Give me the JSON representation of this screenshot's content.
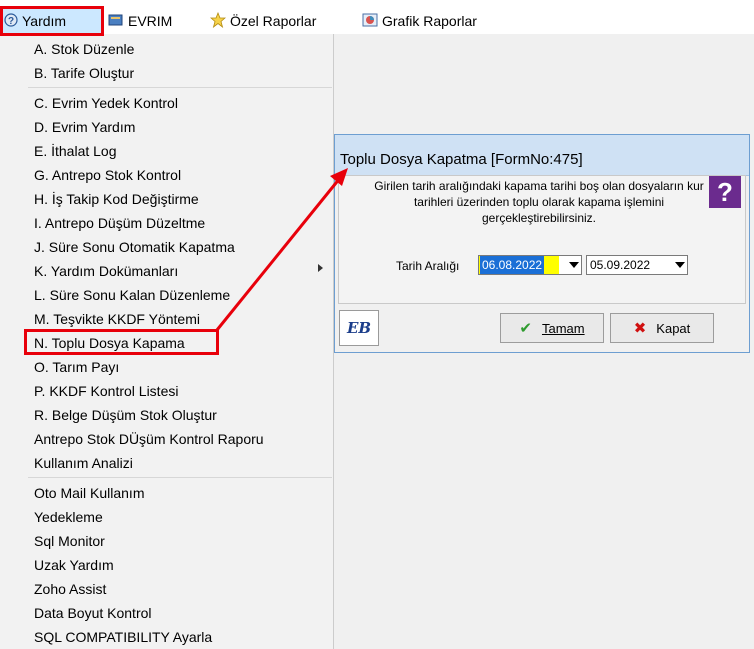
{
  "menubar": {
    "items": [
      {
        "label": "Yardım",
        "icon": "help-icon"
      },
      {
        "label": "EVRIM",
        "icon": "book-icon"
      },
      {
        "label": "Özel Raporlar",
        "icon": "star-icon"
      },
      {
        "label": "Grafik Raporlar",
        "icon": "chart-icon"
      }
    ]
  },
  "menu": {
    "items": [
      "A.  Stok Düzenle",
      "B.  Tarife Oluştur",
      "C.  Evrim Yedek Kontrol",
      "D.  Evrim Yardım",
      "E.  İthalat Log",
      "G.  Antrepo Stok Kontrol",
      "H.  İş Takip Kod Değiştirme",
      "I.  Antrepo Düşüm Düzeltme",
      "J.  Süre Sonu Otomatik Kapatma",
      "K.  Yardım Dokümanları",
      "L. Süre Sonu Kalan Düzenleme",
      "M. Teşvikte KKDF Yöntemi",
      "N. Toplu Dosya Kapama",
      "O. Tarım Payı",
      "P. KKDF Kontrol Listesi",
      "R. Belge Düşüm Stok Oluştur",
      "Antrepo Stok DÜşüm Kontrol Raporu",
      "Kullanım Analizi",
      "Oto Mail Kullanım",
      "Yedekleme",
      "Sql Monitor",
      "Uzak Yardım",
      "Zoho Assist",
      "Data Boyut Kontrol",
      "SQL COMPATIBILITY Ayarla"
    ]
  },
  "dialog": {
    "title": "Toplu Dosya Kapatma [FormNo:475]",
    "description": "Girilen tarih aralığındaki kapama tarihi boş olan dosyaların kur tarihleri üzerinden toplu olarak kapama işlemini gerçekleştirebilirsiniz.",
    "date_label": "Tarih Aralığı",
    "start_date": "06.08.2022",
    "end_date": "05.09.2022",
    "logo_text": "EB",
    "ok_label": "Tamam",
    "close_label": "Kapat"
  },
  "colors": {
    "highlight": "#e8000b",
    "selection": "#1a6fd6",
    "input_highlight": "#ffff00"
  }
}
